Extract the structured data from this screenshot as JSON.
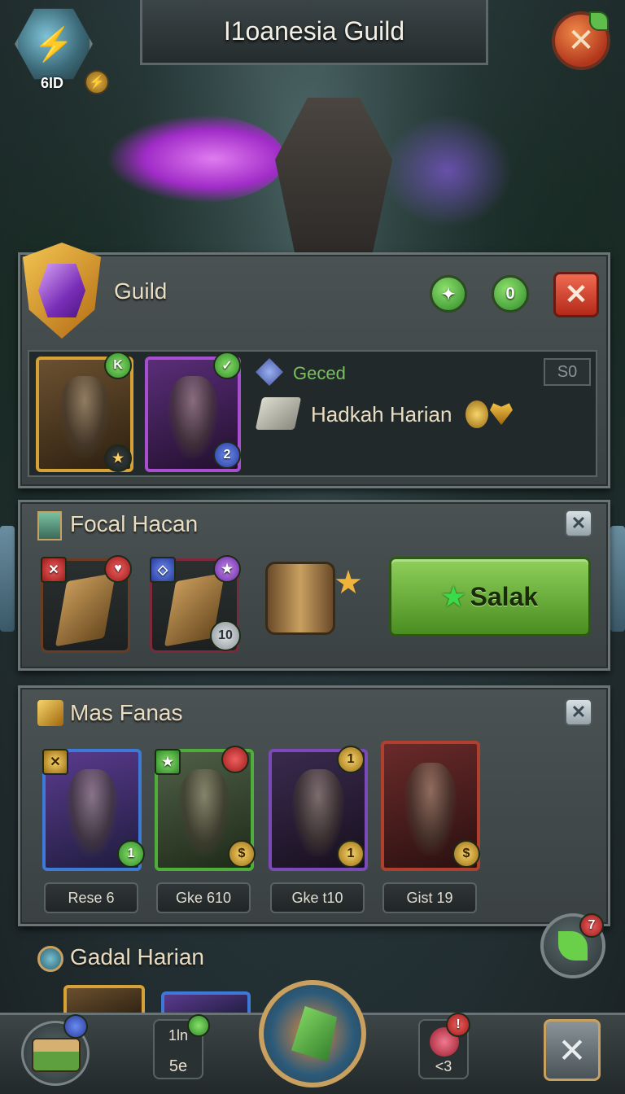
{
  "header": {
    "title": "I1oanesia Guild",
    "level": "6ID",
    "level_coin_symbol": "⚡"
  },
  "guild_panel": {
    "title": "Guild",
    "btn1_symbol": "✦",
    "btn2_label": "0",
    "close_symbol": "✕",
    "hero1_badge": "K",
    "hero1_star": "★",
    "hero2_badge": "✓",
    "hero2_level": "2",
    "status_label": "Geced",
    "status_value": "S0",
    "quest_text": "Hadkah Harian"
  },
  "focal_panel": {
    "title": "Focal Hacan",
    "close_symbol": "✕",
    "item1_badge": "✕",
    "item1_badge2": "♥",
    "item2_badge": "◇",
    "item2_badge2": "★",
    "item2_count": "10",
    "action_label": "Salak",
    "action_icon": "★"
  },
  "heroes_panel": {
    "title": "Mas Fanas",
    "close_symbol": "✕",
    "heroes": [
      {
        "flag": "✕",
        "badge": "1",
        "label": "Rese 6"
      },
      {
        "flag": "★",
        "badge": "$",
        "label": "Gke 610"
      },
      {
        "flag": "",
        "badge": "1",
        "top_badge": "1",
        "label": "Gke t10"
      },
      {
        "flag": "",
        "badge": "$",
        "label": "Gist 19"
      }
    ]
  },
  "daily": {
    "title": "Gadal Harian",
    "notification_count": "7"
  },
  "bottom_bar": {
    "stat_top": "1ln",
    "stat_bottom": "5e",
    "alert_count": "!",
    "alert_sub": "<3",
    "close_symbol": "✕"
  },
  "colors": {
    "accent_green": "#5ebd4b",
    "accent_gold": "#d6a238",
    "close_red": "#b42a1a"
  }
}
